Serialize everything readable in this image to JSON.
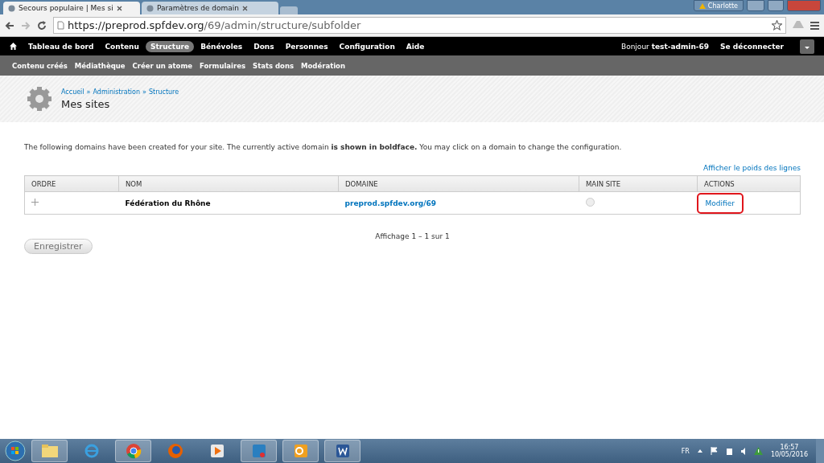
{
  "browser": {
    "tabs": [
      {
        "title": "Secours populaire | Mes si",
        "selected": true
      },
      {
        "title": "Paramètres de domain",
        "selected": false
      }
    ],
    "profile": "Charlotte",
    "address": {
      "host": "https://preprod.spfdev.org",
      "path": "/69/admin/structure/subfolder"
    }
  },
  "toolbar": {
    "items": [
      {
        "label": "Tableau de bord",
        "selected": false
      },
      {
        "label": "Contenu",
        "selected": false
      },
      {
        "label": "Structure",
        "selected": true
      },
      {
        "label": "Bénévoles",
        "selected": false
      },
      {
        "label": "Dons",
        "selected": false
      },
      {
        "label": "Personnes",
        "selected": false
      },
      {
        "label": "Configuration",
        "selected": false
      },
      {
        "label": "Aide",
        "selected": false
      }
    ],
    "greeting": "Bonjour **test-admin-69**",
    "logout": "Se déconnecter"
  },
  "shortcuts": [
    "Contenu créés",
    "Médiathèque",
    "Créer un atome",
    "Formulaires",
    "Stats dons",
    "Modération"
  ],
  "breadcrumb": [
    "Accueil",
    "Administration",
    "Structure"
  ],
  "breadcrumb_separator": "»",
  "page_title": "Mes sites",
  "intro": "The following domains have been created for your site. The currently active domain **is shown in boldface.** You may click on a domain to change the configuration.",
  "weights_link": "Afficher le poids des lignes",
  "table": {
    "columns": [
      "ORDRE",
      "NOM",
      "DOMAINE",
      "MAIN SITE",
      "ACTIONS"
    ],
    "rows": [
      {
        "name": "Fédération du Rhône",
        "domain": "preprod.spfdev.org/69",
        "main_site": {
          "selected": false
        },
        "action": "Modifier",
        "highlighted": true
      }
    ]
  },
  "pager": "Affichage 1 – 1 sur 1",
  "save_button": "Enregistrer",
  "taskbar": {
    "language": "FR",
    "time": "16:57",
    "date": "10/05/2016"
  }
}
